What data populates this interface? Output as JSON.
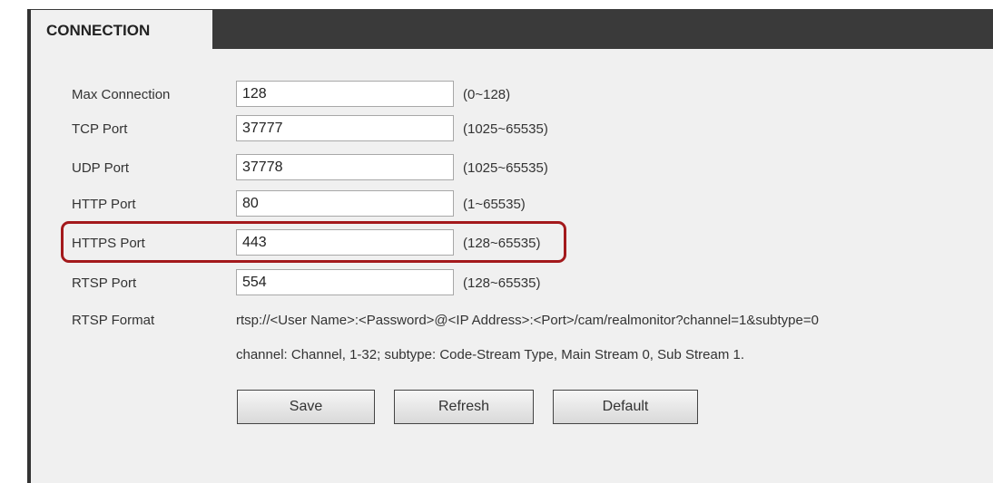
{
  "tab": {
    "title": "CONNECTION"
  },
  "fields": [
    {
      "label": "Max Connection",
      "value": "128",
      "range": "(0~128)"
    },
    {
      "label": "TCP Port",
      "value": "37777",
      "range": "(1025~65535)"
    },
    {
      "label": "UDP Port",
      "value": "37778",
      "range": "(1025~65535)"
    },
    {
      "label": "HTTP Port",
      "value": "80",
      "range": "(1~65535)"
    },
    {
      "label": "HTTPS Port",
      "value": "443",
      "range": "(128~65535)"
    },
    {
      "label": "RTSP Port",
      "value": "554",
      "range": "(128~65535)"
    }
  ],
  "rtsp": {
    "label": "RTSP Format",
    "format": "rtsp://<User Name>:<Password>@<IP Address>:<Port>/cam/realmonitor?channel=1&subtype=0",
    "note": "channel: Channel, 1-32; subtype: Code-Stream Type, Main Stream 0, Sub Stream 1."
  },
  "buttons": {
    "save": "Save",
    "refresh": "Refresh",
    "default": "Default"
  },
  "colors": {
    "highlight": "#a3191c",
    "topbar": "#3a3a3a",
    "panel": "#f0f0f0"
  }
}
